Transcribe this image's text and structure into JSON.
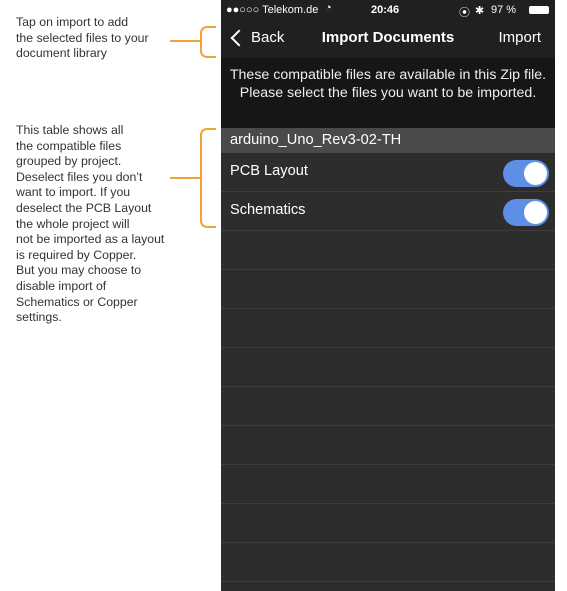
{
  "annotations": {
    "import_note": "Tap on import to add\nthe selected files to your\ndocument library",
    "table_note": "This table shows all\nthe compatible files\ngrouped by project.\nDeselect files you don’t\nwant to import. If you\ndeselect the PCB Layout\nthe whole project will\nnot be imported as a layout\nis required by Copper.\nBut you may choose to\ndisable import of\nSchematics or Copper\nsettings."
  },
  "status_bar": {
    "carrier": "●●○○○ Telekom.de",
    "time": "20:46",
    "battery": "97 %"
  },
  "navbar": {
    "back_label": "Back",
    "title": "Import Documents",
    "import_label": "Import"
  },
  "info_text": "These compatible files are available in this Zip file. Please select the files you want to be imported.",
  "section": {
    "title": "arduino_Uno_Rev3-02-TH",
    "items": [
      {
        "label": "PCB Layout",
        "enabled": true
      },
      {
        "label": "Schematics",
        "enabled": true
      }
    ]
  },
  "colors": {
    "accent": "#f2a23a",
    "toggle_on": "#5e8fe6"
  }
}
